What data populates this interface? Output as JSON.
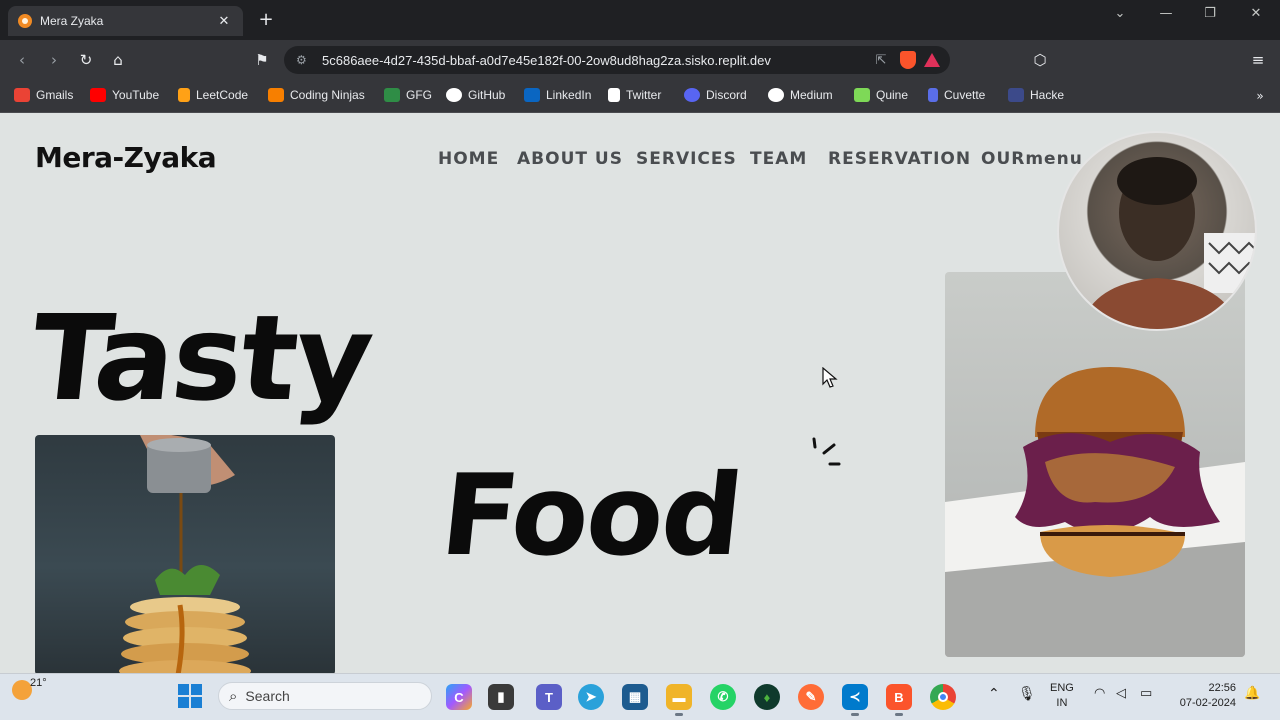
{
  "browser": {
    "tab_title": "Mera Zyaka",
    "tab_close": "✕",
    "new_tab": "+",
    "url": "5c686aee-4d27-435d-bbaf-a0d7e45e182f-00-2ow8ud8hag2za.sisko.replit.dev",
    "bookmarks": [
      {
        "label": "Gmails",
        "icon_color": "#ea4335"
      },
      {
        "label": "YouTube",
        "icon_color": "#ff0000"
      },
      {
        "label": "LeetCode",
        "icon_color": "#ffa116"
      },
      {
        "label": "Coding Ninjas",
        "icon_color": "#f77f00"
      },
      {
        "label": "GFG",
        "icon_color": "#2f8d46"
      },
      {
        "label": "GitHub",
        "icon_color": "#ffffff"
      },
      {
        "label": "LinkedIn",
        "icon_color": "#0a66c2"
      },
      {
        "label": "Twitter",
        "icon_color": "#ffffff"
      },
      {
        "label": "Discord",
        "icon_color": "#5865f2"
      },
      {
        "label": "Medium",
        "icon_color": "#ffffff"
      },
      {
        "label": "Quine",
        "icon_color": "#7ed957"
      },
      {
        "label": "Cuvette",
        "icon_color": "#5a6ee8"
      },
      {
        "label": "Hacke",
        "icon_color": "#3c4a8a"
      }
    ]
  },
  "site": {
    "brand": "Mera-Zyaka",
    "nav": [
      "HOME",
      "ABOUT US",
      "SERVICES",
      "TEAM",
      "RESERVATION",
      "OURmenu"
    ],
    "hero_word_1": "Tasty",
    "hero_word_2": "Food"
  },
  "taskbar": {
    "temperature": "21°",
    "search_label": "Search",
    "apps": [
      "copilot",
      "file-explorer-dark",
      "teams",
      "telegram",
      "mysql-workbench",
      "file-explorer",
      "whatsapp",
      "mongodb-compass",
      "postman",
      "vscode",
      "brave",
      "chrome"
    ],
    "lang_line1": "ENG",
    "lang_line2": "IN",
    "time": "22:56",
    "date": "07-02-2024"
  }
}
